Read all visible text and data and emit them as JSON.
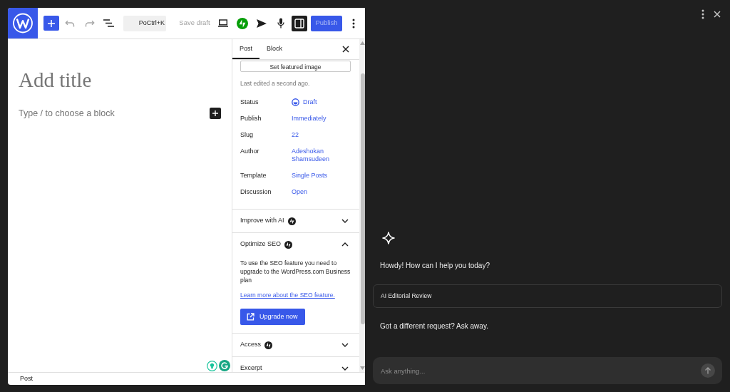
{
  "editor": {
    "toolbar": {
      "undo": {
        "disabled": true
      },
      "redo": {
        "disabled": true
      },
      "command_bar": {
        "title": "Po",
        "shortcut": "Ctrl+K"
      },
      "save_draft": {
        "label": "Save draft",
        "disabled": true
      },
      "settings_open": true,
      "publish": {
        "label": "Publish",
        "disabled": true
      }
    },
    "canvas": {
      "title": {
        "placeholder": "Add title"
      },
      "block": {
        "placeholder": "Type / to choose a block"
      }
    },
    "sidebar": {
      "tabs": [
        {
          "label": "Post",
          "selected": true
        },
        {
          "label": "Block",
          "selected": false
        }
      ],
      "featured_image_button": "Set featured image",
      "last_edited": "Last edited a second ago.",
      "fields": [
        {
          "label": "Status",
          "value": "Draft",
          "kind": "status"
        },
        {
          "label": "Publish",
          "value": "Immediately",
          "kind": "link"
        },
        {
          "label": "Slug",
          "value": "22",
          "kind": "link"
        },
        {
          "label": "Author",
          "value": "Adeshokan Shamsudeen",
          "kind": "link"
        },
        {
          "label": "Template",
          "value": "Single Posts",
          "kind": "link"
        },
        {
          "label": "Discussion",
          "value": "Open",
          "kind": "link"
        }
      ],
      "panels": [
        {
          "title": "Improve with AI",
          "badge": true,
          "expanded": false
        },
        {
          "title": "Optimize SEO",
          "badge": true,
          "expanded": true,
          "body": "To use the SEO feature you need to upgrade to the WordPress.com Business plan",
          "link": "Learn more about the SEO feature.",
          "button": "Upgrade now"
        },
        {
          "title": "Access",
          "badge": true,
          "expanded": false
        },
        {
          "title": "Excerpt",
          "badge": false,
          "expanded": false
        }
      ]
    },
    "footer": {
      "breadcrumb": "Post"
    }
  },
  "assistant": {
    "greeting": "Howdy! How can I help you today?",
    "suggestions": [
      {
        "label": "AI Editorial Review"
      }
    ],
    "prompt": "Got a different request? Ask away.",
    "input": {
      "placeholder": "Ask anything..."
    }
  }
}
